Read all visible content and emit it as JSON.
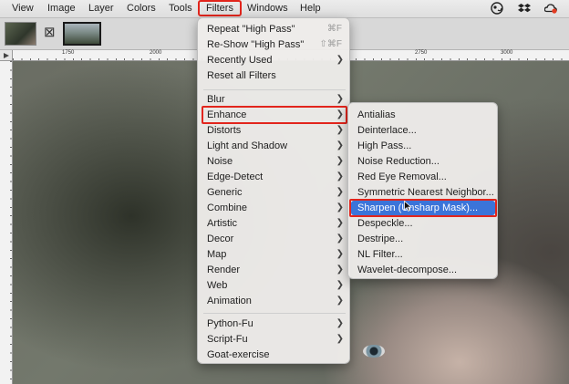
{
  "menubar": {
    "items": [
      "View",
      "Image",
      "Layer",
      "Colors",
      "Tools",
      "Filters",
      "Windows",
      "Help"
    ],
    "active": "Filters"
  },
  "tray_icons": [
    "gimp-icon",
    "dropbox-icon",
    "creative-cloud-icon"
  ],
  "close_tab_glyph": "⊠",
  "ruler": {
    "h_labels": [
      "1750",
      "2000",
      "2750",
      "3000"
    ]
  },
  "filters_menu": {
    "repeat": {
      "label": "Repeat \"High Pass\"",
      "shortcut": "⌘F"
    },
    "reshow": {
      "label": "Re-Show \"High Pass\"",
      "shortcut": "⇧⌘F"
    },
    "recently_used": "Recently Used",
    "reset": "Reset all Filters",
    "groups": [
      "Blur",
      "Enhance",
      "Distorts",
      "Light and Shadow",
      "Noise",
      "Edge-Detect",
      "Generic",
      "Combine",
      "Artistic",
      "Decor",
      "Map",
      "Render",
      "Web",
      "Animation"
    ],
    "python_fu": "Python-Fu",
    "script_fu": "Script-Fu",
    "goat": "Goat-exercise",
    "highlighted": "Enhance"
  },
  "enhance_menu": {
    "items": [
      "Antialias",
      "Deinterlace...",
      "High Pass...",
      "Noise Reduction...",
      "Red Eye Removal...",
      "Symmetric Nearest Neighbor...",
      "Sharpen (Unsharp Mask)...",
      "Despeckle...",
      "Destripe...",
      "NL Filter...",
      "Wavelet-decompose..."
    ],
    "selected": "Sharpen (Unsharp Mask)..."
  },
  "colors": {
    "accent": "#3b74d9",
    "annotation": "#e2251c"
  }
}
